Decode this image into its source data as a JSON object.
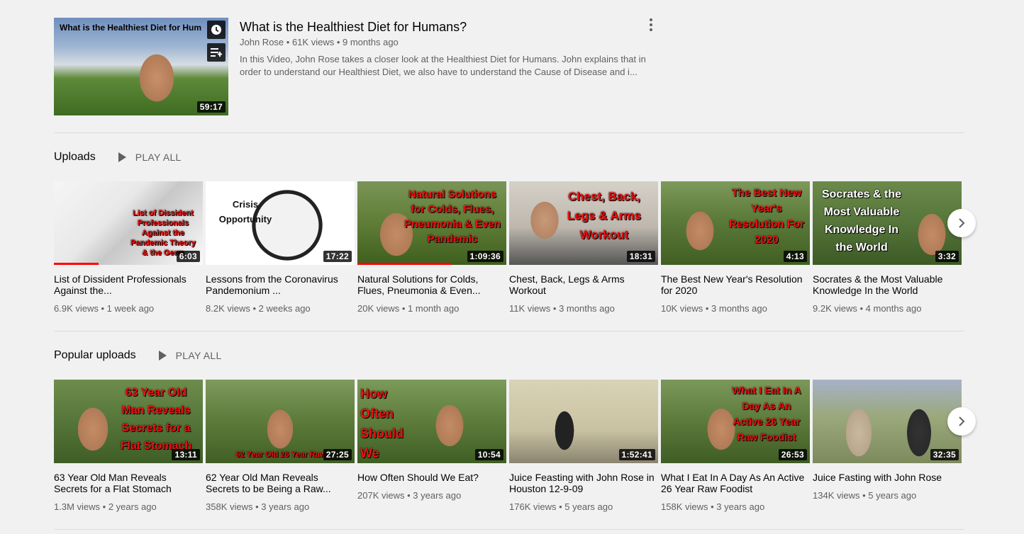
{
  "featured": {
    "thumb_text": "What is the Healthiest Diet for Hum",
    "duration": "59:17",
    "title": "What is the Healthiest Diet for Humans?",
    "channel": "John Rose",
    "views": "61K views",
    "age": "9 months ago",
    "description": "In this Video, John Rose takes a closer look at the Healthiest Diet for Humans. John explains that in order to understand our Healthiest Diet, we also have to understand the Cause of Disease and i...",
    "icons": [
      "clock-icon",
      "queue-icon",
      "more-vert-icon"
    ]
  },
  "uploads": {
    "title": "Uploads",
    "play_all": "PLAY ALL",
    "videos": [
      {
        "thumb_text": "List of Dissident Professionals Against the Pandemic Theory & the Germ",
        "duration": "6:03",
        "title": "List of Dissident Professionals Against the...",
        "views": "6.9K views",
        "age": "1 week ago",
        "progress": 0.3
      },
      {
        "thumb_text": "Crisis Opportunity",
        "duration": "17:22",
        "title": "Lessons from the Coronavirus Pandemonium ...",
        "views": "8.2K views",
        "age": "2 weeks ago"
      },
      {
        "thumb_text": "Natural Solutions for Colds, Flues, Pneumonia & Even Pandemic",
        "duration": "1:09:36",
        "title": "Natural Solutions for Colds, Flues, Pneumonia & Even...",
        "views": "20K views",
        "age": "1 month ago",
        "progress": 0.63
      },
      {
        "thumb_text": "Chest, Back, Legs & Arms Workout",
        "duration": "18:31",
        "title": "Chest, Back, Legs & Arms Workout",
        "views": "11K views",
        "age": "3 months ago"
      },
      {
        "thumb_text": "The Best New Year's Resolution For 2020",
        "duration": "4:13",
        "title": "The Best New Year's Resolution for 2020",
        "views": "10K views",
        "age": "3 months ago"
      },
      {
        "thumb_text": "Socrates & the Most Valuable Knowledge In the World",
        "duration": "3:32",
        "title": "Socrates & the Most Valuable Knowledge In the World",
        "views": "9.2K views",
        "age": "4 months ago"
      }
    ]
  },
  "popular": {
    "title": "Popular uploads",
    "play_all": "PLAY ALL",
    "videos": [
      {
        "thumb_text": "63 Year Old Man Reveals Secrets for a Flat Stomach",
        "duration": "13:11",
        "title": "63 Year Old Man Reveals Secrets for a Flat Stomach",
        "views": "1.3M views",
        "age": "2 years ago"
      },
      {
        "thumb_text": "62 Year Old 26 Year Raw",
        "duration": "27:25",
        "title": "62 Year Old Man Reveals Secrets to be Being a Raw...",
        "views": "358K views",
        "age": "3 years ago"
      },
      {
        "thumb_text": "How Often Should We Eat?",
        "duration": "10:54",
        "title": "How Often Should We Eat?",
        "views": "207K views",
        "age": "3 years ago"
      },
      {
        "thumb_text": "",
        "duration": "1:52:41",
        "title": "Juice Feasting with John Rose in Houston 12-9-09",
        "views": "176K views",
        "age": "5 years ago"
      },
      {
        "thumb_text": "What I Eat In A Day As An Active 26 Year Raw Foodist",
        "duration": "26:53",
        "title": "What I Eat In A Day As An Active 26 Year Raw Foodist",
        "views": "158K views",
        "age": "3 years ago"
      },
      {
        "thumb_text": "",
        "duration": "32:35",
        "title": "Juice Fasting with John Rose",
        "views": "134K views",
        "age": "5 years ago"
      }
    ]
  },
  "next_icon": "chevron-right-icon",
  "colors": {
    "background": "#f1f1f1",
    "meta_text": "#606060",
    "progress": "#ff0000"
  }
}
